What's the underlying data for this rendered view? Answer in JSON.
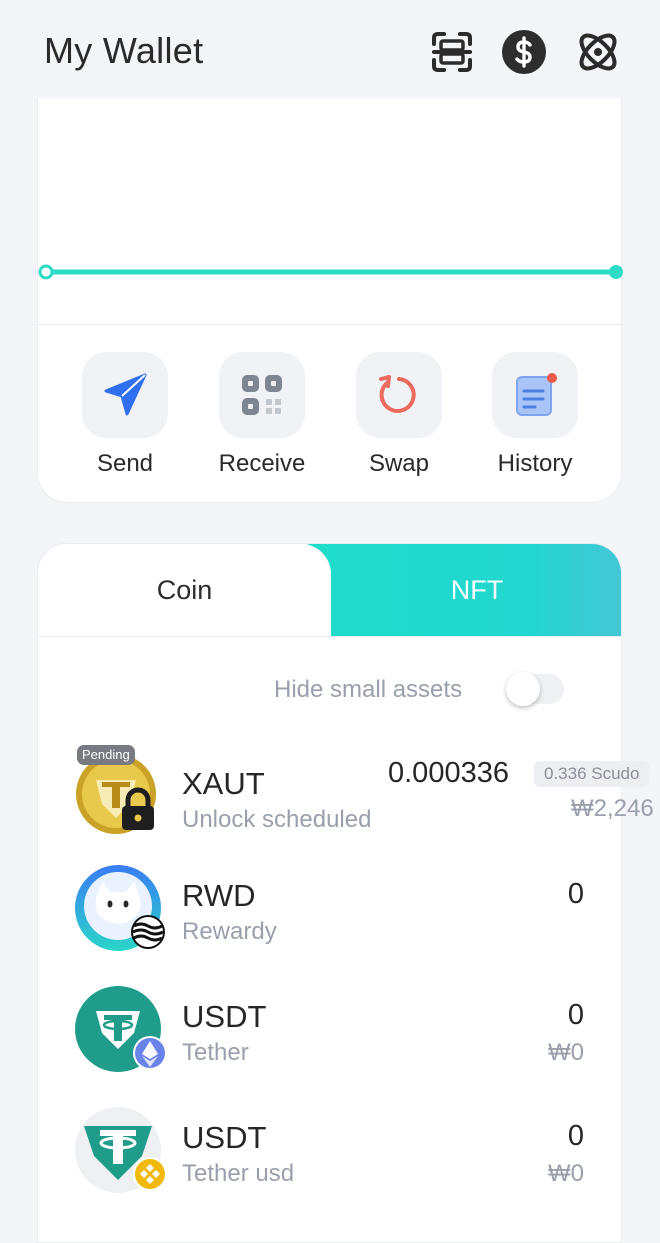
{
  "header": {
    "title": "My Wallet"
  },
  "header_icons": [
    "scan-icon",
    "dollar-icon",
    "atom-icon"
  ],
  "actions": [
    {
      "label": "Send",
      "icon": "send-icon"
    },
    {
      "label": "Receive",
      "icon": "qr-icon"
    },
    {
      "label": "Swap",
      "icon": "swap-icon"
    },
    {
      "label": "History",
      "icon": "history-icon"
    }
  ],
  "tabs": {
    "coin": "Coin",
    "nft": "NFT",
    "active": "NFT"
  },
  "filter": {
    "hide_small_assets": "Hide small assets",
    "enabled": false
  },
  "assets": [
    {
      "symbol": "XAUT",
      "name": "Unlock scheduled",
      "quantity": "0.000336",
      "fiat": "₩2,246",
      "badge": "Pending",
      "secondary_amount": "0.336 Scudo"
    },
    {
      "symbol": "RWD",
      "name": "Rewardy",
      "quantity": "0",
      "fiat": ""
    },
    {
      "symbol": "USDT",
      "name": "Tether",
      "quantity": "0",
      "fiat": "₩0"
    },
    {
      "symbol": "USDT",
      "name": "Tether usd",
      "quantity": "0",
      "fiat": "₩0"
    }
  ],
  "colors": {
    "accent": "#1fdccb",
    "chart_line": "#2ddcc6",
    "text_muted": "#9aa0ab"
  }
}
